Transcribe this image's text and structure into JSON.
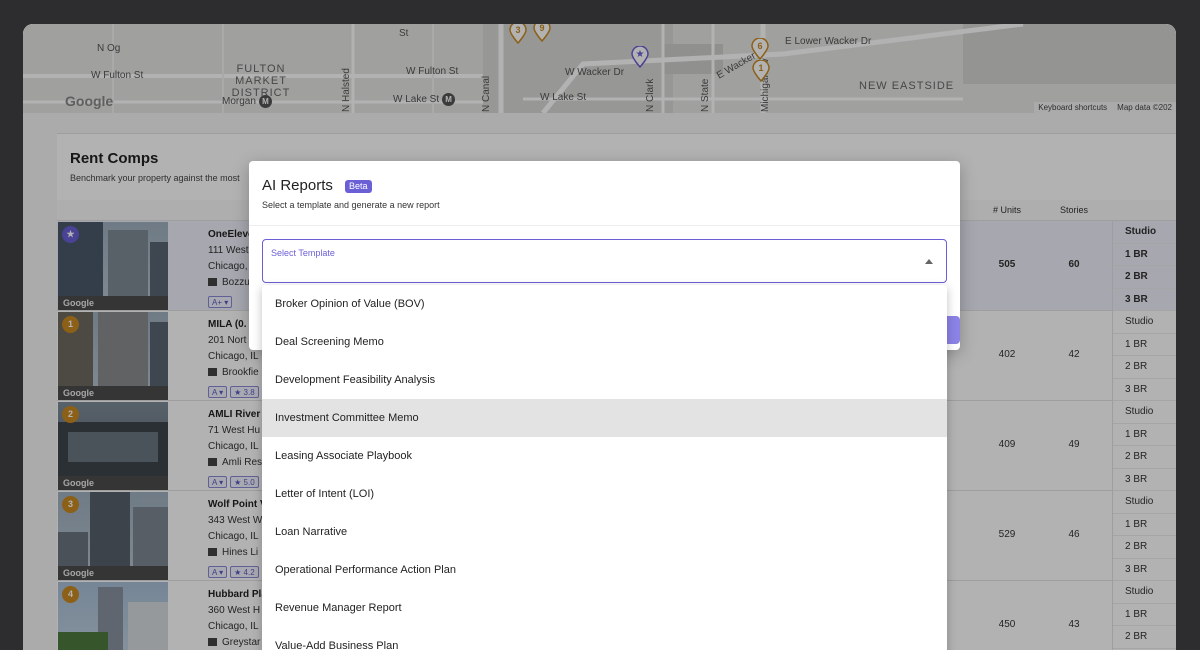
{
  "map": {
    "labels": {
      "w_fulton_st_1": "W Fulton St",
      "fulton_market_district": "FULTON MARKET DISTRICT",
      "morgan": "Morgan",
      "w_fulton_st_2": "W Fulton St",
      "w_lake_st_1": "W Lake St",
      "n_halsted": "N Halsted",
      "n_canal": "N Canal",
      "w_wacker_dr": "W Wacker Dr",
      "w_lake_st_2": "W Lake St",
      "n_clark": "N Clark",
      "n_state": "N State",
      "e_wacker_dr": "E Wacker Dr",
      "e_lower_wacker_dr": "E Lower Wacker Dr",
      "michigan_av": "Michigan Av",
      "new_eastside": "NEW EASTSIDE",
      "n_og": "N Og",
      "st": "St"
    },
    "metro_symbol": "M",
    "google_logo": "Google",
    "footer": {
      "keyboard_shortcuts": "Keyboard shortcuts",
      "map_data": "Map data ©202"
    },
    "pins": [
      "3",
      "9",
      "6",
      "1"
    ]
  },
  "rent_comps": {
    "title": "Rent Comps",
    "subtitle": "Benchmark your property against the most",
    "columns": {
      "units": "# Units",
      "stories": "Stories"
    },
    "rows": [
      {
        "badge": "★",
        "name": "OneEleve",
        "address": "111 West",
        "city": "Chicago, ",
        "owner": "Bozzu",
        "chip1": "A+ ▾",
        "chip2": "",
        "units": "505",
        "stories": "60",
        "types": [
          "Studio",
          "1 BR",
          "2 BR",
          "3 BR"
        ]
      },
      {
        "badge": "1",
        "name": "MILA (0.",
        "address": "201 Nort",
        "city": "Chicago, IL",
        "owner": "Brookfie",
        "chip1": "A ▾",
        "chip2": "★ 3.8",
        "units": "402",
        "stories": "42",
        "types": [
          "Studio",
          "1 BR",
          "2 BR",
          "3 BR"
        ]
      },
      {
        "badge": "2",
        "name": "AMLI River",
        "address": "71 West Hu",
        "city": "Chicago, IL",
        "owner": "Amli Res",
        "chip1": "A ▾",
        "chip2": "★ 5.0",
        "units": "409",
        "stories": "49",
        "types": [
          "Studio",
          "1 BR",
          "2 BR",
          "3 BR"
        ]
      },
      {
        "badge": "3",
        "name": "Wolf Point V",
        "address": "343 West W",
        "city": "Chicago, IL",
        "owner": "Hines Li",
        "chip1": "A ▾",
        "chip2": "★ 4.2",
        "units": "529",
        "stories": "46",
        "types": [
          "Studio",
          "1 BR",
          "2 BR",
          "3 BR"
        ]
      },
      {
        "badge": "4",
        "name": "Hubbard Pla",
        "address": "360 West H",
        "city": "Chicago, IL",
        "owner": "Greystar",
        "chip1": "",
        "chip2": "",
        "units": "450",
        "stories": "43",
        "types": [
          "Studio",
          "1 BR",
          "2 BR",
          ""
        ]
      }
    ],
    "photo_watermark": "Google"
  },
  "modal": {
    "title": "AI Reports",
    "badge": "Beta",
    "subtitle": "Select a template and generate a new report",
    "select_label": "Select Template"
  },
  "dropdown": {
    "options": [
      "Broker Opinion of Value (BOV)",
      "Deal Screening Memo",
      "Development Feasibility Analysis",
      "Investment Committee Memo",
      "Leasing Associate Playbook",
      "Letter of Intent (LOI)",
      "Loan Narrative",
      "Operational Performance Action Plan",
      "Revenue Manager Report",
      "Value-Add Business Plan"
    ],
    "hovered_index": 3
  },
  "colors": {
    "accent": "#6b5fd6",
    "pin": "#c98a21",
    "backdrop": "#2d2d2f"
  }
}
